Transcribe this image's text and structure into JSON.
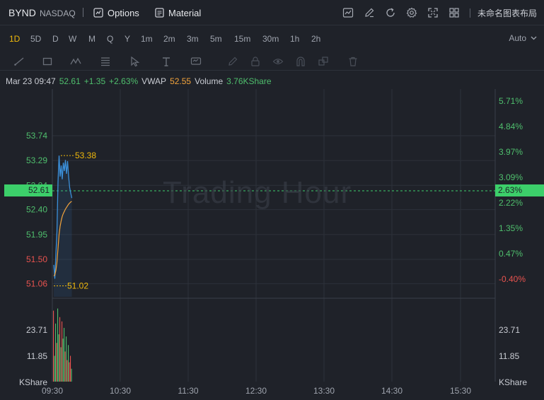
{
  "header": {
    "ticker": "BYND",
    "exchange": "NASDAQ",
    "options_label": "Options",
    "material_label": "Material",
    "layout_name": "未命名图表布局",
    "icons": [
      "candle-chart-icon",
      "pencil-icon",
      "refresh-icon",
      "gear-icon",
      "fullscreen-icon",
      "grid-layout-icon"
    ]
  },
  "intervals": {
    "items": [
      "1D",
      "5D",
      "D",
      "W",
      "M",
      "Q",
      "Y",
      "1m",
      "2m",
      "3m",
      "5m",
      "15m",
      "30m",
      "1h",
      "2h"
    ],
    "active": "1D",
    "scale_label": "Auto"
  },
  "legend": {
    "datetime": "Mar 23 09:47",
    "price": "52.61",
    "change": "+1.35",
    "change_pct": "+2.63%",
    "vwap_label": "VWAP",
    "vwap_value": "52.55",
    "volume_label": "Volume",
    "volume_value": "3.76KShare"
  },
  "colors": {
    "up": "#4fbf6d",
    "down": "#e8534f",
    "price_line": "#3b8fd9",
    "vwap_line": "#f2a33c",
    "accent": "#f0b90b",
    "background": "#1f2229",
    "grid": "#2d313a"
  },
  "chart_data": {
    "type": "line",
    "watermark": "Trading Hour",
    "left_axis": [
      "53.74",
      "53.29",
      "52.84",
      "52.40",
      "51.95",
      "51.50",
      "51.06"
    ],
    "right_axis": [
      "5.71%",
      "4.84%",
      "3.97%",
      "3.09%",
      "2.22%",
      "1.35%",
      "0.47%",
      "-0.40%"
    ],
    "current_price": "52.61",
    "current_pct": "2.63%",
    "high_label": "53.38",
    "low_label": "51.02",
    "ylim": [
      50.95,
      54.2
    ],
    "x_ticks": [
      "09:30",
      "10:30",
      "11:30",
      "12:30",
      "13:30",
      "14:30",
      "15:30"
    ],
    "price_series": {
      "name": "Price",
      "x": [
        0,
        1,
        2,
        3,
        4,
        5,
        6,
        7,
        8,
        9,
        10,
        11,
        12,
        13,
        14,
        15,
        16,
        17
      ],
      "values": [
        51.4,
        51.15,
        51.6,
        52.0,
        52.9,
        53.38,
        53.0,
        53.2,
        52.95,
        53.25,
        53.1,
        53.3,
        53.05,
        53.28,
        53.0,
        52.8,
        52.7,
        52.61
      ]
    },
    "vwap_series": {
      "name": "VWAP",
      "x": [
        0,
        1,
        2,
        3,
        4,
        5,
        6,
        7,
        8,
        9,
        10,
        11,
        12,
        13,
        14,
        15,
        16,
        17
      ],
      "values": [
        51.2,
        51.22,
        51.3,
        51.45,
        51.7,
        51.95,
        52.1,
        52.2,
        52.28,
        52.33,
        52.37,
        52.41,
        52.44,
        52.47,
        52.5,
        52.52,
        52.54,
        52.55
      ]
    },
    "volume": {
      "axis": [
        "23.71",
        "11.85"
      ],
      "unit": "KShare",
      "ylim": [
        0,
        35.5
      ],
      "values": [
        33,
        12,
        27,
        18,
        34,
        22,
        30,
        16,
        28,
        20,
        25,
        14,
        21,
        10,
        17,
        9,
        12,
        6
      ],
      "colors": [
        "r",
        "g",
        "g",
        "r",
        "g",
        "g",
        "r",
        "g",
        "r",
        "g",
        "g",
        "r",
        "g",
        "r",
        "g",
        "r",
        "r",
        "g"
      ]
    }
  }
}
